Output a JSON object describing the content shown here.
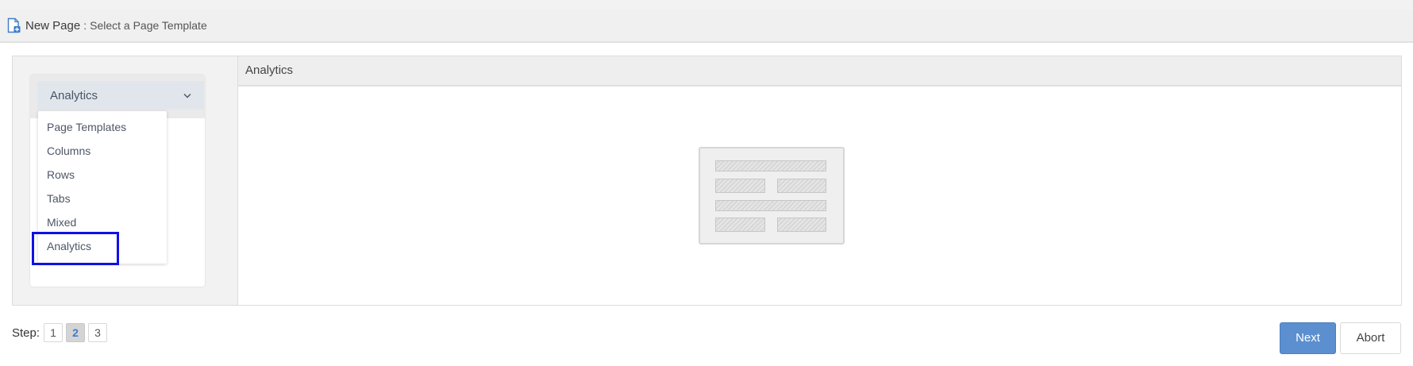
{
  "header": {
    "title": "New Page",
    "separator": ":",
    "subtitle": "Select a Page Template",
    "icon": "new-page-icon"
  },
  "sidebar": {
    "select": {
      "value": "Analytics",
      "icon": "chevron-down-icon"
    },
    "dropdown_items": [
      {
        "label": "Page Templates"
      },
      {
        "label": "Columns"
      },
      {
        "label": "Rows"
      },
      {
        "label": "Tabs"
      },
      {
        "label": "Mixed"
      },
      {
        "label": "Analytics",
        "selected": true
      }
    ]
  },
  "preview": {
    "title": "Analytics",
    "thumbnail": "layout-template-preview"
  },
  "steps": {
    "label": "Step:",
    "items": [
      "1",
      "2",
      "3"
    ],
    "active_index": 1
  },
  "actions": {
    "next_label": "Next",
    "abort_label": "Abort"
  },
  "colors": {
    "primary": "#5b8fcf",
    "highlight": "#1010e6",
    "header_bg": "#f0f0f0"
  }
}
